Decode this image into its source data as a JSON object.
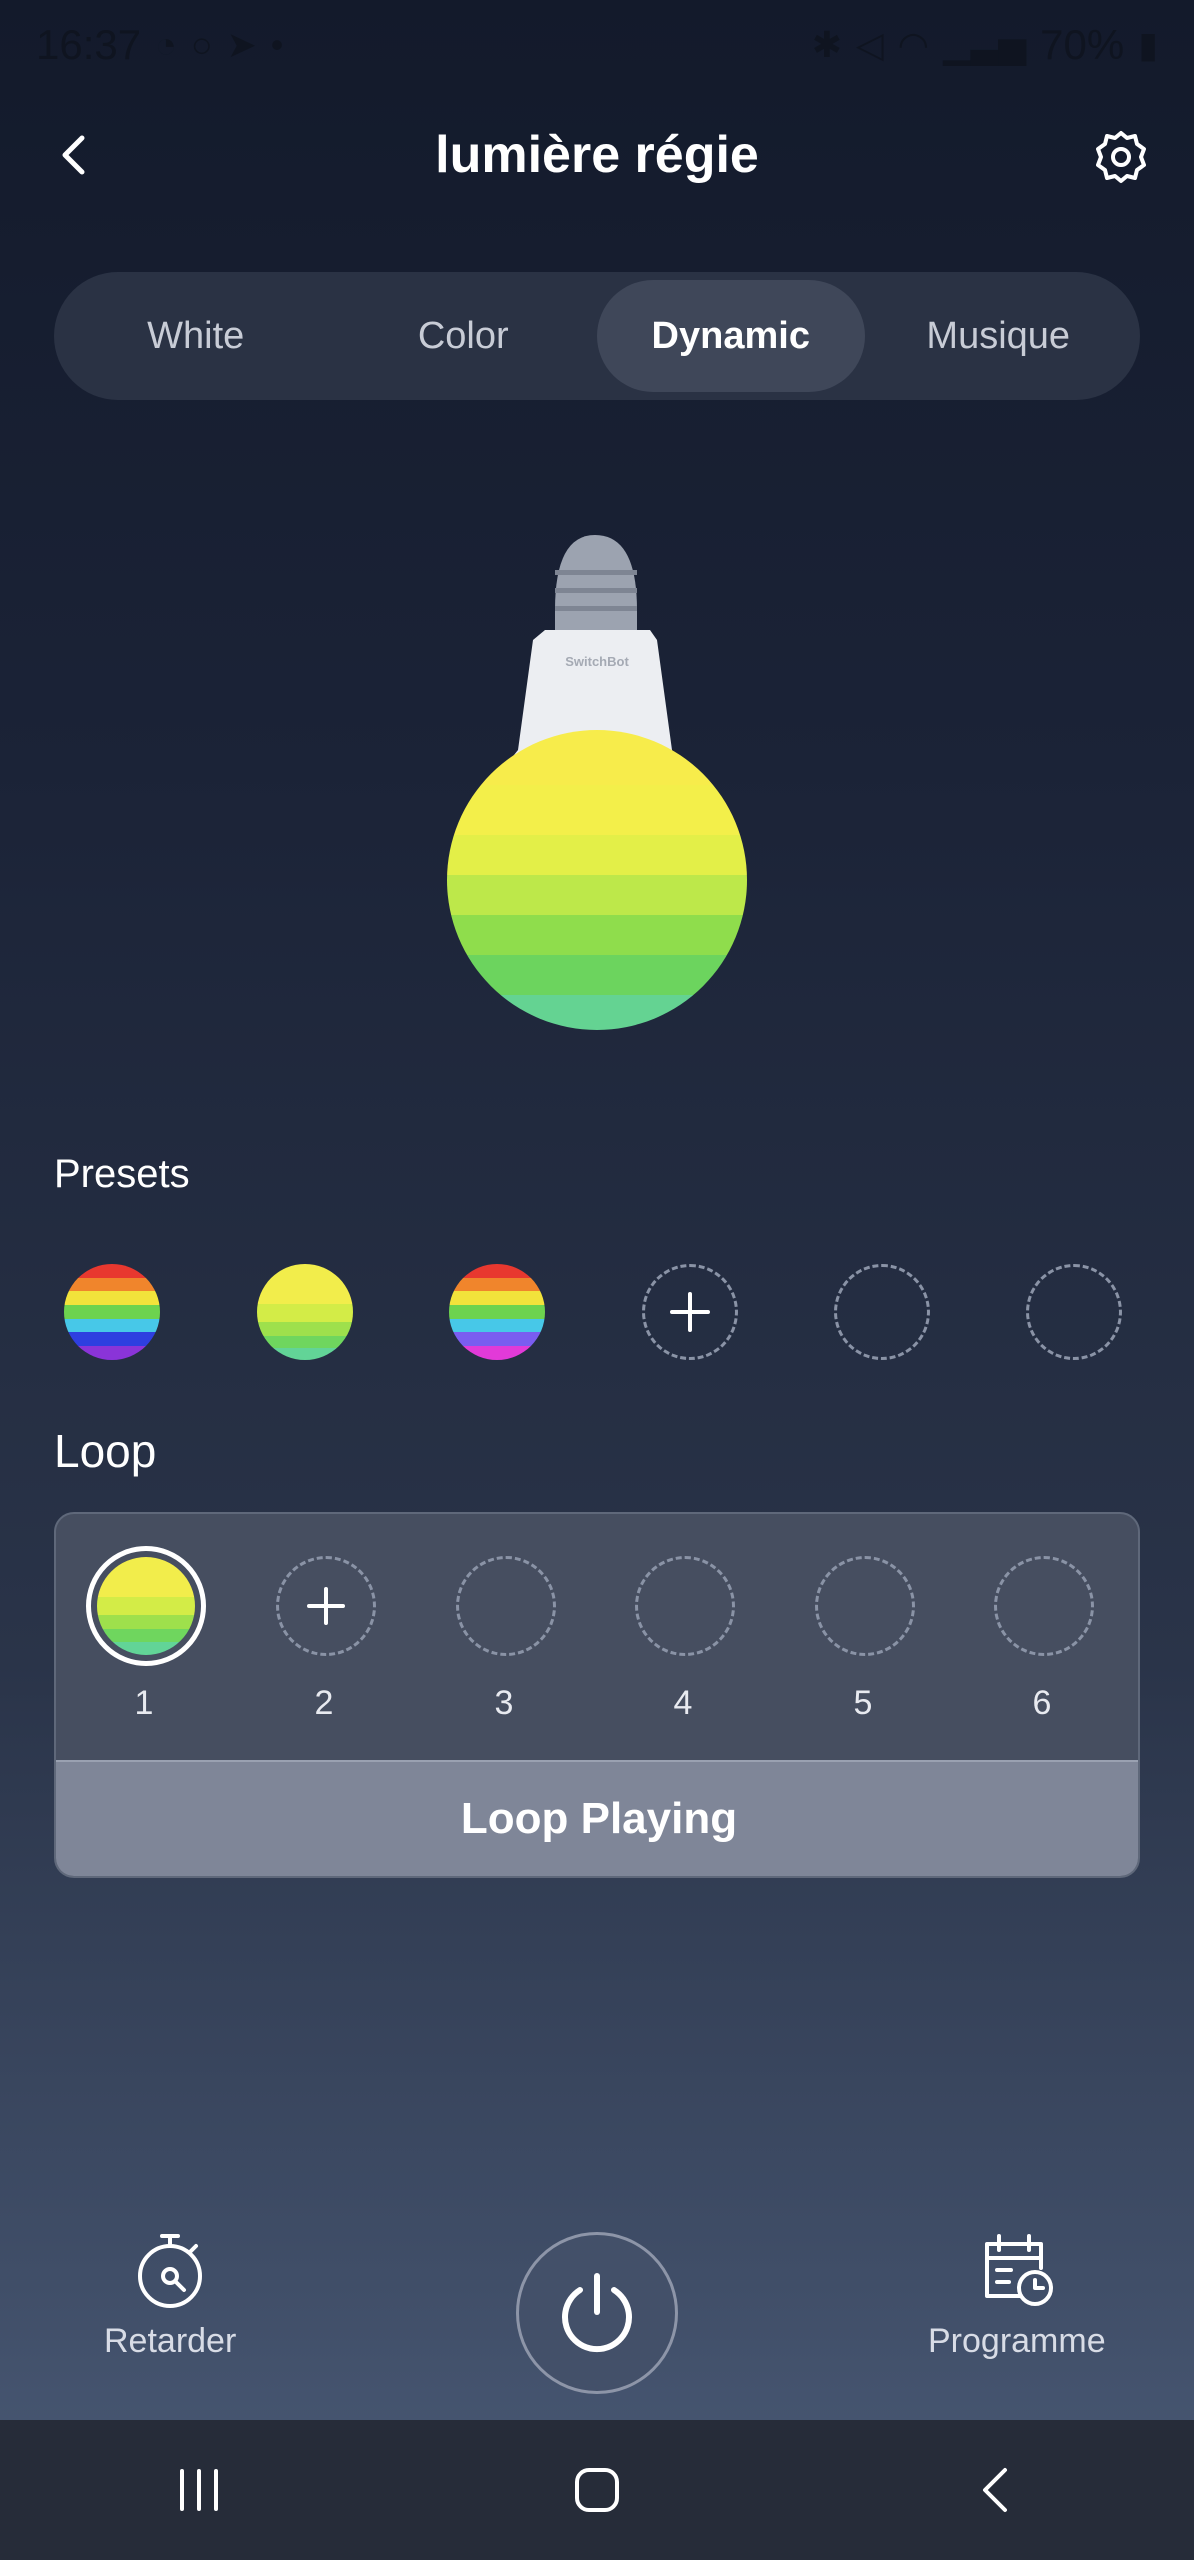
{
  "status_bar": {
    "time": "16:37",
    "battery": "70%"
  },
  "header": {
    "title": "lumière régie"
  },
  "tabs": [
    {
      "label": "White",
      "active": false
    },
    {
      "label": "Color",
      "active": false
    },
    {
      "label": "Dynamic",
      "active": true
    },
    {
      "label": "Musique",
      "active": false
    }
  ],
  "bulb": {
    "brand": "SwitchBot"
  },
  "presets": {
    "label": "Presets",
    "items": [
      {
        "type": "rainbow"
      },
      {
        "type": "yellow-green"
      },
      {
        "type": "rainbow-magenta"
      },
      {
        "type": "add"
      },
      {
        "type": "empty"
      },
      {
        "type": "empty"
      }
    ]
  },
  "loop": {
    "label": "Loop",
    "slots": [
      {
        "number": "1",
        "state": "filled-selected"
      },
      {
        "number": "2",
        "state": "add"
      },
      {
        "number": "3",
        "state": "empty"
      },
      {
        "number": "4",
        "state": "empty"
      },
      {
        "number": "5",
        "state": "empty"
      },
      {
        "number": "6",
        "state": "empty"
      }
    ],
    "button_label": "Loop Playing"
  },
  "actions": {
    "delay_label": "Retarder",
    "schedule_label": "Programme"
  },
  "icons": [
    "back-arrow-icon",
    "gear-icon",
    "timer-icon",
    "power-icon",
    "calendar-clock-icon",
    "recents-icon",
    "home-icon",
    "nav-back-icon",
    "plus-icon"
  ]
}
